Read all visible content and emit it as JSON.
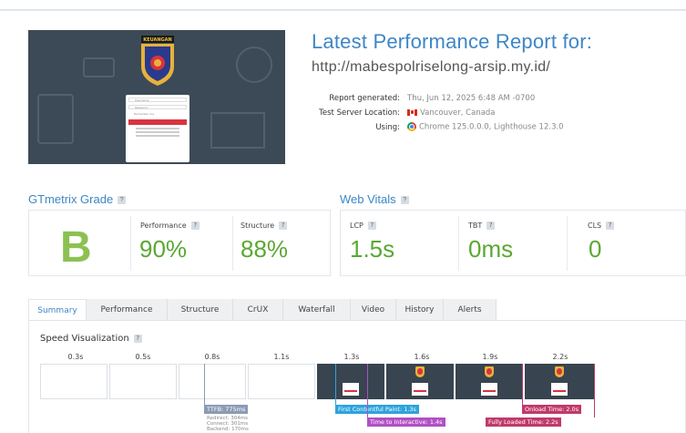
{
  "thumbnail": {
    "site_name": "KEUANGAN",
    "login_fields": [
      "Username",
      "Password",
      "Remember me"
    ],
    "login_button": "Submit"
  },
  "report": {
    "title": "Latest Performance Report for:",
    "url": "http://mabespolriselong-arsip.my.id/",
    "generated_label": "Report generated:",
    "generated_value": "Thu, Jun 12, 2025 6:48 AM -0700",
    "location_label": "Test Server Location:",
    "location_value": "Vancouver, Canada",
    "using_label": "Using:",
    "using_value": "Chrome 125.0.0.0, Lighthouse 12.3.0"
  },
  "grade_section": {
    "heading": "GTmetrix Grade",
    "help": "?",
    "grade": "B",
    "grade_color": "#8cc152",
    "performance_label": "Performance",
    "performance_value": "90%",
    "structure_label": "Structure",
    "structure_value": "88%"
  },
  "vitals_section": {
    "heading": "Web Vitals",
    "help": "?",
    "lcp_label": "LCP",
    "lcp_value": "1.5s",
    "tbt_label": "TBT",
    "tbt_value": "0ms",
    "cls_label": "CLS",
    "cls_value": "0"
  },
  "tabs": [
    "Summary",
    "Performance",
    "Structure",
    "CrUX",
    "Waterfall",
    "Video",
    "History",
    "Alerts"
  ],
  "active_tab": "Summary",
  "speed": {
    "heading": "Speed Visualization",
    "help": "?",
    "times": [
      "0.3s",
      "0.5s",
      "0.8s",
      "1.1s",
      "1.3s",
      "1.6s",
      "1.9s",
      "2.2s"
    ],
    "ttfb": "TTFB: 775ms",
    "ttfb_details": [
      "Redirect: 304ms",
      "Connect: 301ms",
      "Backend: 170ms"
    ],
    "fcp": "First Contentful Paint: 1.3s",
    "tti": "Time to Interactive: 1.4s",
    "onload": "Onload Time: 2.0s",
    "fully_loaded": "Fully Loaded Time: 2.2s"
  },
  "colors": {
    "accent": "#3d86c6",
    "grade_green": "#8cc152",
    "metric_green": "#5aa832",
    "ttfb": "#8a9bb5",
    "fcp": "#2ea3dc",
    "tti": "#b14fc5",
    "onload": "#c0396b",
    "fully_loaded": "#c0396b"
  }
}
